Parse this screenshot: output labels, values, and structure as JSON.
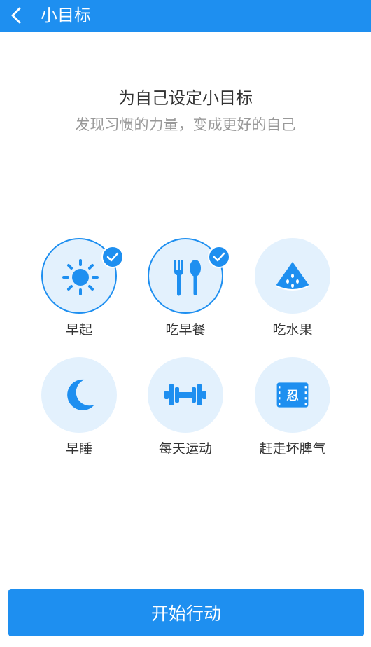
{
  "header": {
    "title": "小目标",
    "back_icon": "chevron-left-icon"
  },
  "intro": {
    "headline": "为自己设定小目标",
    "subline": "发现习惯的力量，变成更好的自己"
  },
  "goals": [
    {
      "label": "早起",
      "icon": "sun-icon",
      "selected": true
    },
    {
      "label": "吃早餐",
      "icon": "fork-spoon-icon",
      "selected": true
    },
    {
      "label": "吃水果",
      "icon": "watermelon-icon",
      "selected": false
    },
    {
      "label": "早睡",
      "icon": "moon-icon",
      "selected": false
    },
    {
      "label": "每天运动",
      "icon": "dumbbell-icon",
      "selected": false
    },
    {
      "label": "赶走坏脾气",
      "icon": "ren-ticket-icon",
      "ticket_text": "忍",
      "selected": false
    }
  ],
  "start_button": {
    "label": "开始行动"
  },
  "colors": {
    "accent": "#1e8ff0",
    "icon_bg": "#e3f1fd"
  }
}
